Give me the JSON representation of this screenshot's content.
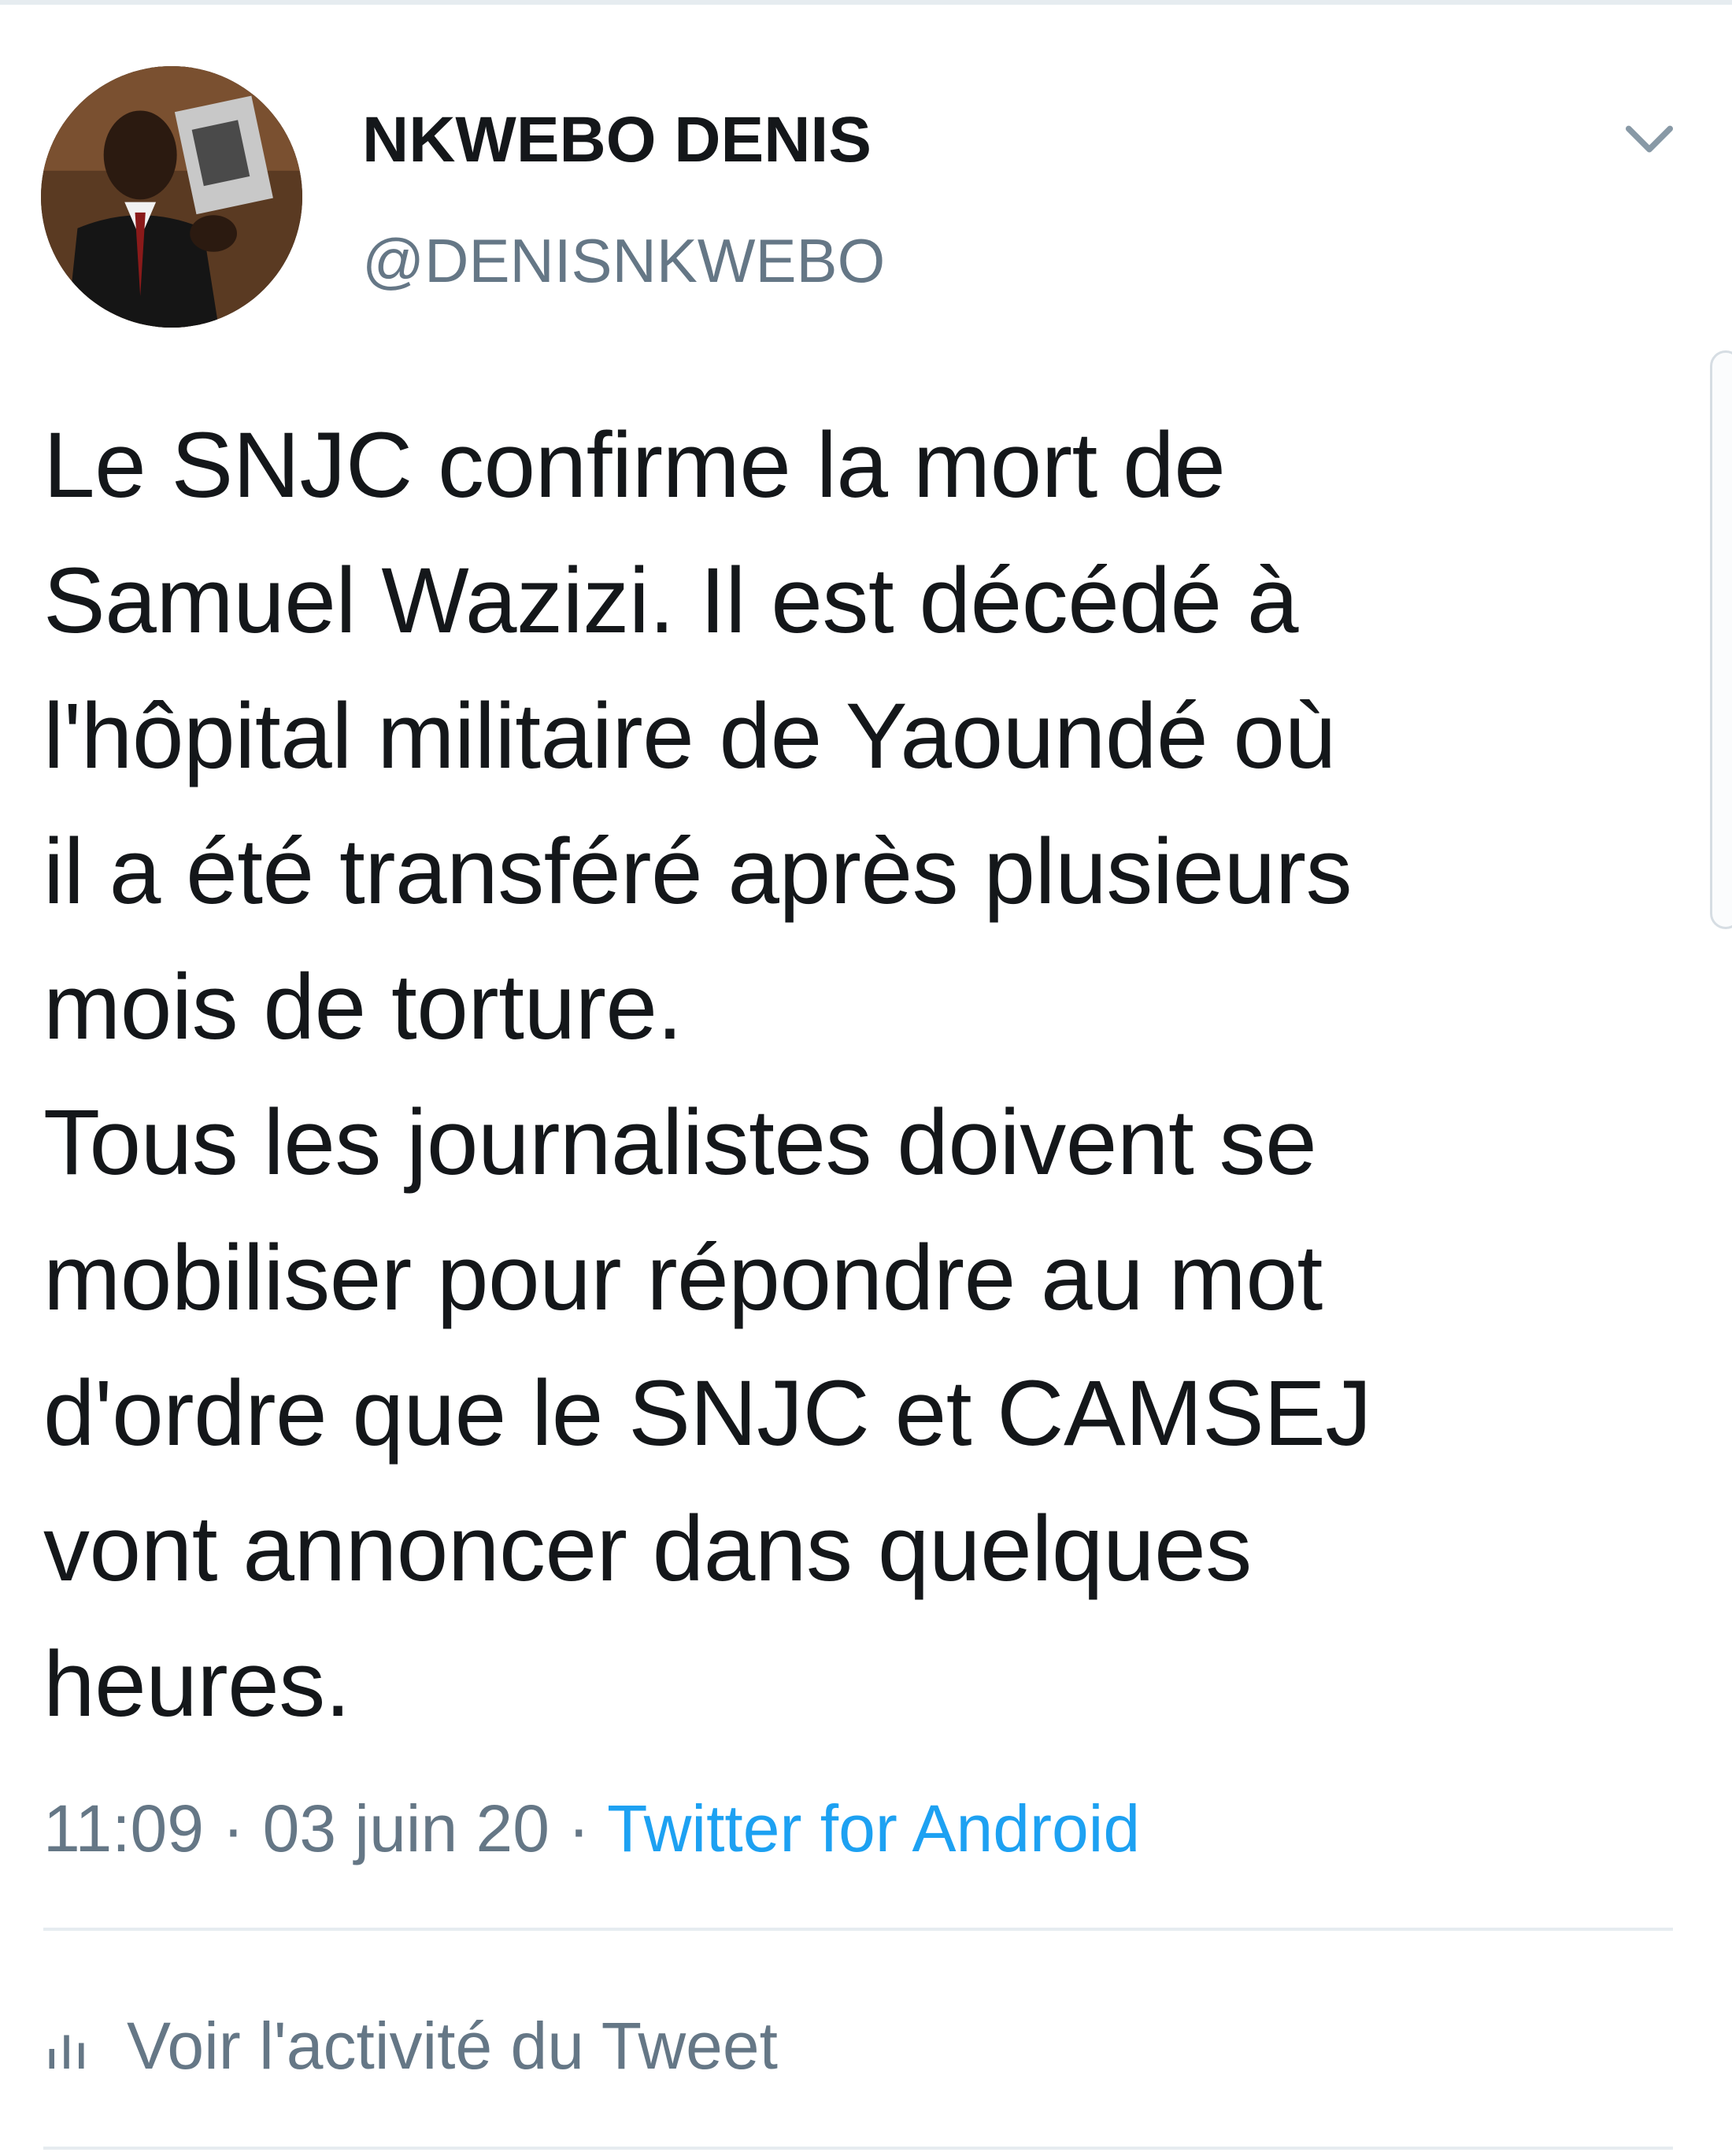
{
  "tweet": {
    "author": {
      "display_name": "NKWEBO DENIS",
      "handle": "@DENISNKWEBO",
      "avatar_icon": "user-avatar-photo"
    },
    "menu_icon": "chevron-down-icon",
    "text": "Le SNJC confirme la mort de\nSamuel Wazizi. Il est décédé à\nl'hôpital militaire de Yaoundé où\nil a été transféré après plusieurs\nmois de torture.\nTous les journalistes doivent se\nmobiliser pour répondre au mot\nd'ordre que le SNJC et CAMSEJ\nvont annoncer dans quelques\nheures.",
    "time": "11:09",
    "separator": " · ",
    "date": "03 juin 20",
    "source": "Twitter for Android",
    "activity_label": "Voir l'activité du Tweet",
    "activity_icon": "analytics-bars-icon"
  },
  "colors": {
    "text": "#14171a",
    "secondary": "#657786",
    "link": "#1da1f2",
    "divider": "#e6ecf0"
  }
}
